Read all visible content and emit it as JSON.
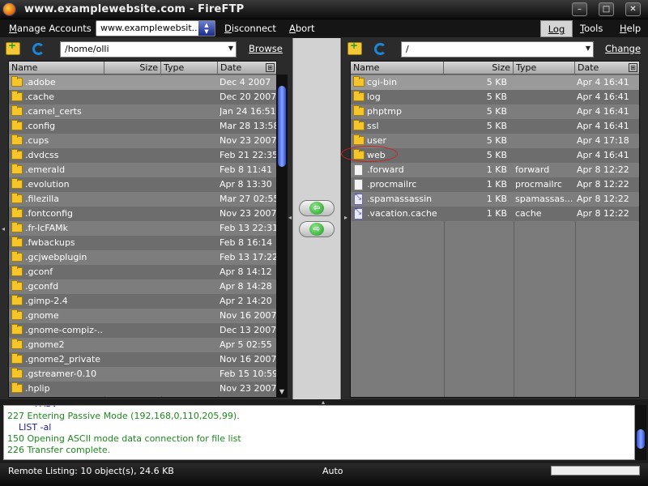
{
  "window": {
    "title": "www.examplewebsite.com - FireFTP",
    "buttons": {
      "minimize": "–",
      "maximize": "□",
      "close": "✕"
    }
  },
  "menubar": {
    "manage_accounts": "Manage Accounts",
    "account_selected": "www.examplewebsit...",
    "disconnect": "Disconnect",
    "abort": "Abort",
    "log": "Log",
    "tools": "Tools",
    "help": "Help"
  },
  "local": {
    "path": "/home/olli",
    "browse": "Browse",
    "columns": {
      "name": "Name",
      "size": "Size",
      "type": "Type",
      "date": "Date"
    },
    "files": [
      {
        "name": ".adobe",
        "size": "",
        "type": "",
        "date": "Dec 4 2007",
        "icon": "folder"
      },
      {
        "name": ".cache",
        "size": "",
        "type": "",
        "date": "Dec 20 2007",
        "icon": "folder"
      },
      {
        "name": ".camel_certs",
        "size": "",
        "type": "",
        "date": "Jan 24 16:51",
        "icon": "folder"
      },
      {
        "name": ".config",
        "size": "",
        "type": "",
        "date": "Mar 28 13:58",
        "icon": "folder"
      },
      {
        "name": ".cups",
        "size": "",
        "type": "",
        "date": "Nov 23 2007",
        "icon": "folder"
      },
      {
        "name": ".dvdcss",
        "size": "",
        "type": "",
        "date": "Feb 21 22:35",
        "icon": "folder"
      },
      {
        "name": ".emerald",
        "size": "",
        "type": "",
        "date": "Feb 8 11:41",
        "icon": "folder"
      },
      {
        "name": ".evolution",
        "size": "",
        "type": "",
        "date": "Apr 8 13:30",
        "icon": "folder"
      },
      {
        "name": ".filezilla",
        "size": "",
        "type": "",
        "date": "Mar 27 02:55",
        "icon": "folder"
      },
      {
        "name": ".fontconfig",
        "size": "",
        "type": "",
        "date": "Nov 23 2007",
        "icon": "folder"
      },
      {
        "name": ".fr-lcFAMk",
        "size": "",
        "type": "",
        "date": "Feb 13 22:31",
        "icon": "folder"
      },
      {
        "name": ".fwbackups",
        "size": "",
        "type": "",
        "date": "Feb 8 16:14",
        "icon": "folder"
      },
      {
        "name": ".gcjwebplugin",
        "size": "",
        "type": "",
        "date": "Feb 13 17:22",
        "icon": "folder"
      },
      {
        "name": ".gconf",
        "size": "",
        "type": "",
        "date": "Apr 8 14:12",
        "icon": "folder"
      },
      {
        "name": ".gconfd",
        "size": "",
        "type": "",
        "date": "Apr 8 14:28",
        "icon": "folder"
      },
      {
        "name": ".gimp-2.4",
        "size": "",
        "type": "",
        "date": "Apr 2 14:20",
        "icon": "folder"
      },
      {
        "name": ".gnome",
        "size": "",
        "type": "",
        "date": "Nov 16 2007",
        "icon": "folder"
      },
      {
        "name": ".gnome-compiz-...",
        "size": "",
        "type": "",
        "date": "Dec 13 2007",
        "icon": "folder"
      },
      {
        "name": ".gnome2",
        "size": "",
        "type": "",
        "date": "Apr 5 02:55",
        "icon": "folder"
      },
      {
        "name": ".gnome2_private",
        "size": "",
        "type": "",
        "date": "Nov 16 2007",
        "icon": "folder"
      },
      {
        "name": ".gstreamer-0.10",
        "size": "",
        "type": "",
        "date": "Feb 15 10:59",
        "icon": "folder"
      },
      {
        "name": ".hplip",
        "size": "",
        "type": "",
        "date": "Nov 23 2007",
        "icon": "folder"
      }
    ]
  },
  "remote": {
    "path": "/",
    "change": "Change",
    "columns": {
      "name": "Name",
      "size": "Size",
      "type": "Type",
      "date": "Date"
    },
    "files": [
      {
        "name": "cgi-bin",
        "size": "5 KB",
        "type": "",
        "date": "Apr 4 16:41",
        "icon": "folder"
      },
      {
        "name": "log",
        "size": "5 KB",
        "type": "",
        "date": "Apr 4 16:41",
        "icon": "folder"
      },
      {
        "name": "phptmp",
        "size": "5 KB",
        "type": "",
        "date": "Apr 4 16:41",
        "icon": "folder"
      },
      {
        "name": "ssl",
        "size": "5 KB",
        "type": "",
        "date": "Apr 4 16:41",
        "icon": "folder"
      },
      {
        "name": "user",
        "size": "5 KB",
        "type": "",
        "date": "Apr 4 17:18",
        "icon": "folder"
      },
      {
        "name": "web",
        "size": "5 KB",
        "type": "",
        "date": "Apr 4 16:41",
        "icon": "folder"
      },
      {
        "name": ".forward",
        "size": "1 KB",
        "type": "forward",
        "date": "Apr 8 12:22",
        "icon": "file"
      },
      {
        "name": ".procmailrc",
        "size": "1 KB",
        "type": "procmailrc",
        "date": "Apr 8 12:22",
        "icon": "file"
      },
      {
        "name": ".spamassassin",
        "size": "1 KB",
        "type": "spamassas...",
        "date": "Apr 8 12:22",
        "icon": "link"
      },
      {
        "name": ".vacation.cache",
        "size": "1 KB",
        "type": "cache",
        "date": "Apr 8 12:22",
        "icon": "link"
      }
    ]
  },
  "transfer": {
    "download_arrow": "⇦",
    "upload_arrow": "⇨"
  },
  "log_lines": [
    {
      "text": "227 Entering Passive Mode (192,168,0,110,205,99).",
      "color": "#1a8a1a"
    },
    {
      "text": "    LIST -al",
      "color": "#1a1aa0"
    },
    {
      "text": "150 Opening ASCII mode data connection for file list",
      "color": "#1a8a1a"
    },
    {
      "text": "226 Transfer complete.",
      "color": "#1a8a1a"
    }
  ],
  "status": {
    "remote_listing": "Remote Listing: 10 object(s), 24.6 KB",
    "mode": "Auto"
  }
}
